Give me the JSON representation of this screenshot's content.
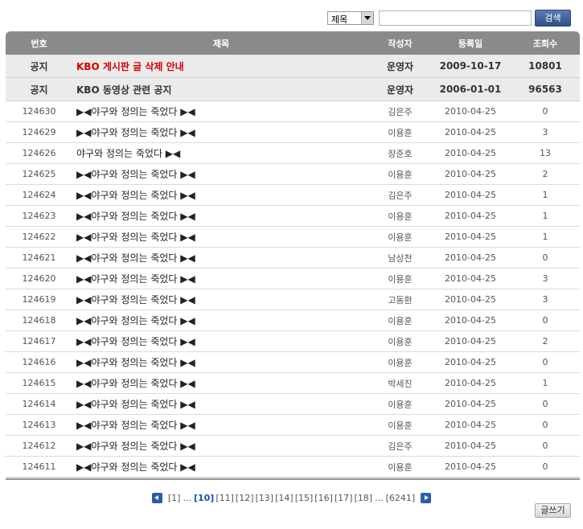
{
  "search": {
    "field_selected": "제목",
    "query": "",
    "button_label": "검색"
  },
  "table": {
    "headers": {
      "number": "번호",
      "title": "제목",
      "author": "작성자",
      "date": "등록일",
      "views": "조회수"
    },
    "notices": [
      {
        "number": "공지",
        "title": "KBO 게시판 글 삭제 안내",
        "author": "운영자",
        "date": "2009-10-17",
        "views": "10801"
      },
      {
        "number": "공지",
        "title": "KBO 동영상 관련 공지",
        "author": "운영자",
        "date": "2006-01-01",
        "views": "96563"
      }
    ],
    "posts": [
      {
        "number": "124630",
        "title": "▶◀야구와 정의는 죽었다 ▶◀",
        "author": "김은주",
        "date": "2010-04-25",
        "views": "0"
      },
      {
        "number": "124629",
        "title": "▶◀야구와 정의는 죽었다 ▶◀",
        "author": "이용훈",
        "date": "2010-04-25",
        "views": "3"
      },
      {
        "number": "124626",
        "title": "야구와 정의는 죽었다 ▶◀",
        "author": "장준호",
        "date": "2010-04-25",
        "views": "13"
      },
      {
        "number": "124625",
        "title": "▶◀야구와 정의는 죽었다 ▶◀",
        "author": "이용훈",
        "date": "2010-04-25",
        "views": "2"
      },
      {
        "number": "124624",
        "title": "▶◀야구와 정의는 죽었다 ▶◀",
        "author": "김은주",
        "date": "2010-04-25",
        "views": "1"
      },
      {
        "number": "124623",
        "title": "▶◀야구와 정의는 죽었다 ▶◀",
        "author": "이용훈",
        "date": "2010-04-25",
        "views": "1"
      },
      {
        "number": "124622",
        "title": "▶◀야구와 정의는 죽었다 ▶◀",
        "author": "이용훈",
        "date": "2010-04-25",
        "views": "1"
      },
      {
        "number": "124621",
        "title": "▶◀야구와 정의는 죽었다 ▶◀",
        "author": "남상천",
        "date": "2010-04-25",
        "views": "0"
      },
      {
        "number": "124620",
        "title": "▶◀야구와 정의는 죽었다 ▶◀",
        "author": "이용훈",
        "date": "2010-04-25",
        "views": "3"
      },
      {
        "number": "124619",
        "title": "▶◀야구와 정의는 죽었다 ▶◀",
        "author": "고동환",
        "date": "2010-04-25",
        "views": "3"
      },
      {
        "number": "124618",
        "title": "▶◀야구와 정의는 죽었다 ▶◀",
        "author": "이용훈",
        "date": "2010-04-25",
        "views": "0"
      },
      {
        "number": "124617",
        "title": "▶◀야구와 정의는 죽었다 ▶◀",
        "author": "이용훈",
        "date": "2010-04-25",
        "views": "2"
      },
      {
        "number": "124616",
        "title": "▶◀야구와 정의는 죽었다 ▶◀",
        "author": "이용훈",
        "date": "2010-04-25",
        "views": "0"
      },
      {
        "number": "124615",
        "title": "▶◀야구와 정의는 죽었다 ▶◀",
        "author": "박세진",
        "date": "2010-04-25",
        "views": "1"
      },
      {
        "number": "124614",
        "title": "▶◀야구와 정의는 죽었다 ▶◀",
        "author": "이용훈",
        "date": "2010-04-25",
        "views": "0"
      },
      {
        "number": "124613",
        "title": "▶◀야구와 정의는 죽었다 ▶◀",
        "author": "이용훈",
        "date": "2010-04-25",
        "views": "0"
      },
      {
        "number": "124612",
        "title": "▶◀야구와 정의는 죽었다 ▶◀",
        "author": "김은주",
        "date": "2010-04-25",
        "views": "0"
      },
      {
        "number": "124611",
        "title": "▶◀야구와 정의는 죽었다 ▶◀",
        "author": "이용훈",
        "date": "2010-04-25",
        "views": "0"
      }
    ]
  },
  "pagination": {
    "first": "[1]",
    "ellipsis_before": "...",
    "current": "[10]",
    "pages": [
      "[11]",
      "[12]",
      "[13]",
      "[14]",
      "[15]",
      "[16]",
      "[17]",
      "[18]"
    ],
    "ellipsis_after": "...",
    "last": "[6241]"
  },
  "write_button_label": "글쓰기",
  "colors": {
    "header_bg": "#8a8a8a",
    "notice_bg": "#ebebeb",
    "notice_highlight": "#d40000",
    "search_button": "#2f4f86",
    "page_current": "#1a4fb5"
  }
}
